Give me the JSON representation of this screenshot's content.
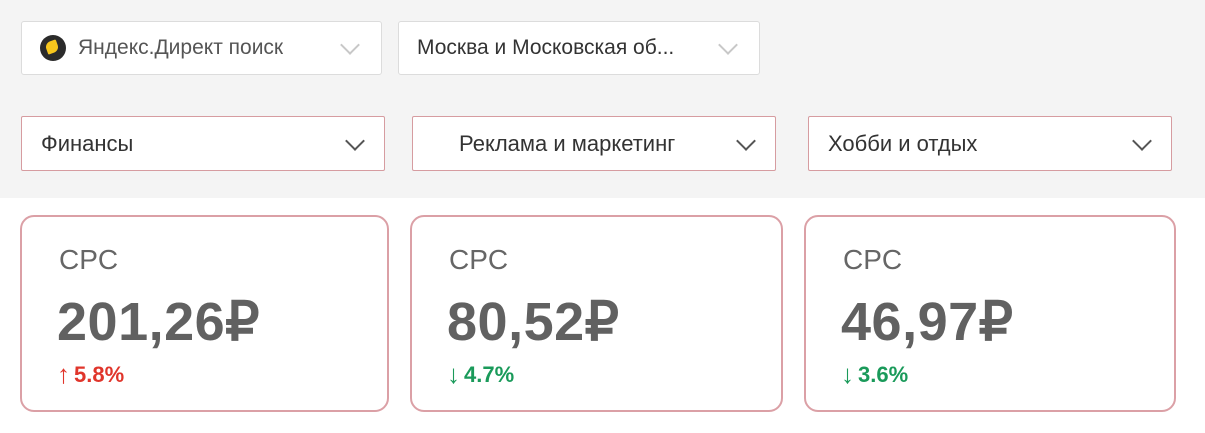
{
  "filters": {
    "source": {
      "label": "Яндекс.Директ поиск",
      "icon": "yandex-logo-icon"
    },
    "region": {
      "label": "Москва и Московская об..."
    }
  },
  "categories": [
    {
      "label": "Финансы"
    },
    {
      "label": "Реклама и маркетинг"
    },
    {
      "label": "Хобби и отдых"
    }
  ],
  "cards": [
    {
      "metric": "CPC",
      "value": "201,26₽",
      "arrow": "↑",
      "change": "5.8%",
      "direction": "up",
      "color": "#e0352b"
    },
    {
      "metric": "CPC",
      "value": "80,52₽",
      "arrow": "↓",
      "change": "4.7%",
      "direction": "down",
      "color": "#1a9a5a"
    },
    {
      "metric": "CPC",
      "value": "46,97₽",
      "arrow": "↓",
      "change": "3.6%",
      "direction": "down",
      "color": "#1a9a5a"
    }
  ]
}
